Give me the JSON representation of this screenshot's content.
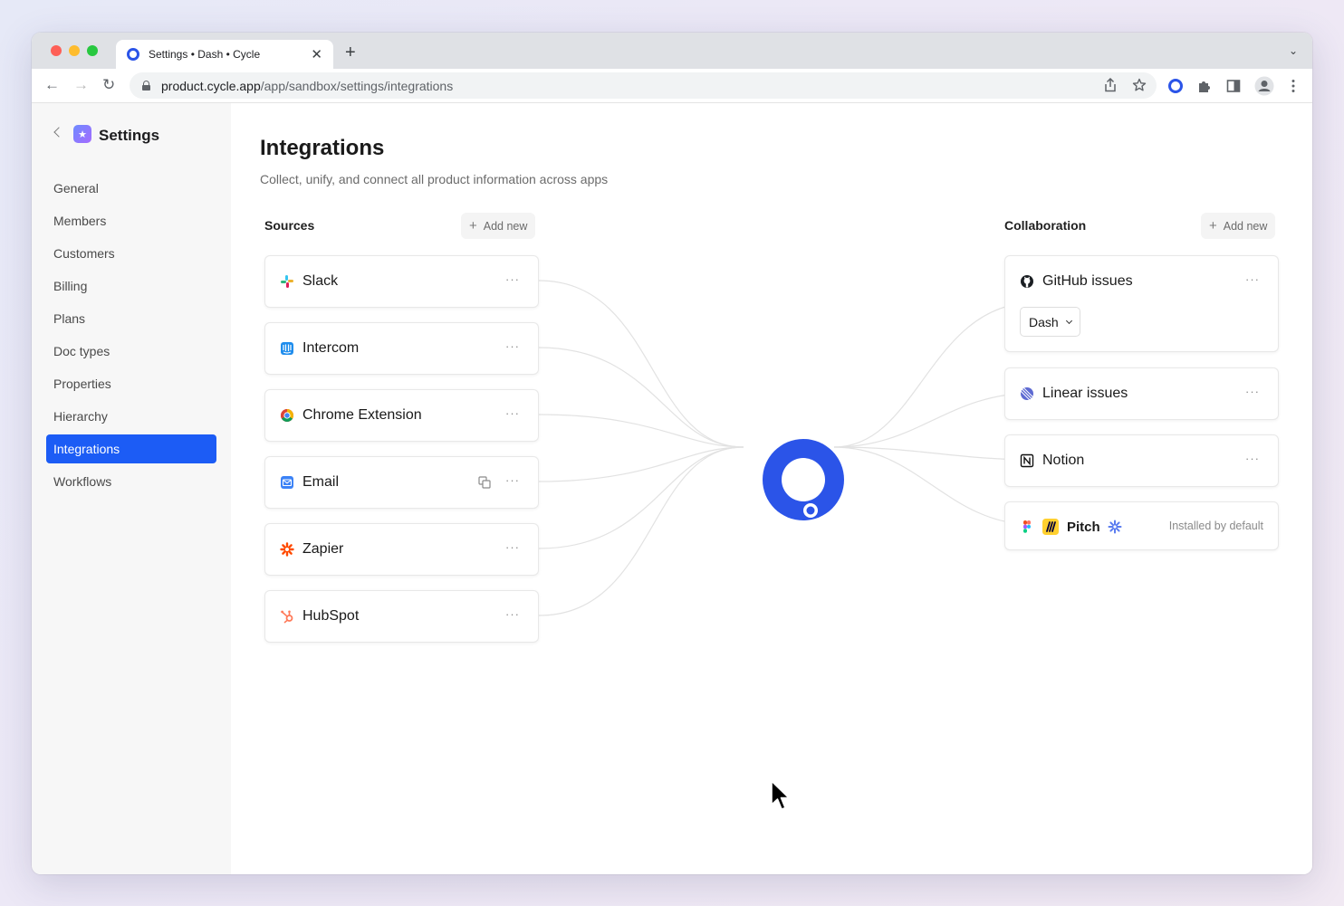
{
  "browser": {
    "tab_title": "Settings • Dash • Cycle",
    "tab_close": "✕",
    "new_tab": "+",
    "tab_menu": "⌄",
    "url_host": "product.cycle.app",
    "url_path": "/app/sandbox/settings/integrations",
    "icons": [
      "back-arrow-icon",
      "forward-arrow-icon",
      "reload-icon",
      "lock-icon",
      "share-icon",
      "star-icon",
      "cycle-extension-icon",
      "puzzle-icon",
      "side-panel-icon",
      "profile-icon",
      "kebab-menu-icon"
    ]
  },
  "sidebar": {
    "title": "Settings",
    "items": [
      {
        "label": "General",
        "active": false
      },
      {
        "label": "Members",
        "active": false
      },
      {
        "label": "Customers",
        "active": false
      },
      {
        "label": "Billing",
        "active": false
      },
      {
        "label": "Plans",
        "active": false
      },
      {
        "label": "Doc types",
        "active": false
      },
      {
        "label": "Properties",
        "active": false
      },
      {
        "label": "Hierarchy",
        "active": false
      },
      {
        "label": "Integrations",
        "active": true
      },
      {
        "label": "Workflows",
        "active": false
      }
    ],
    "accent": "#1c5cf5"
  },
  "main": {
    "title": "Integrations",
    "subtitle": "Collect, unify, and connect all product information across apps",
    "sources": {
      "heading": "Sources",
      "add_label": "Add new",
      "items": [
        {
          "label": "Slack",
          "icon": "slack-icon"
        },
        {
          "label": "Intercom",
          "icon": "intercom-icon"
        },
        {
          "label": "Chrome Extension",
          "icon": "chrome-icon"
        },
        {
          "label": "Email",
          "icon": "email-icon"
        },
        {
          "label": "Zapier",
          "icon": "zapier-icon"
        },
        {
          "label": "HubSpot",
          "icon": "hubspot-icon"
        }
      ]
    },
    "collaboration": {
      "heading": "Collaboration",
      "add_label": "Add new",
      "github": {
        "label": "GitHub issues",
        "select_value": "Dash"
      },
      "linear": {
        "label": "Linear issues"
      },
      "notion": {
        "label": "Notion"
      },
      "pitch": {
        "label": "Pitch",
        "note": "Installed by default"
      }
    },
    "more": "···",
    "hub_color": "#2b54e8"
  }
}
